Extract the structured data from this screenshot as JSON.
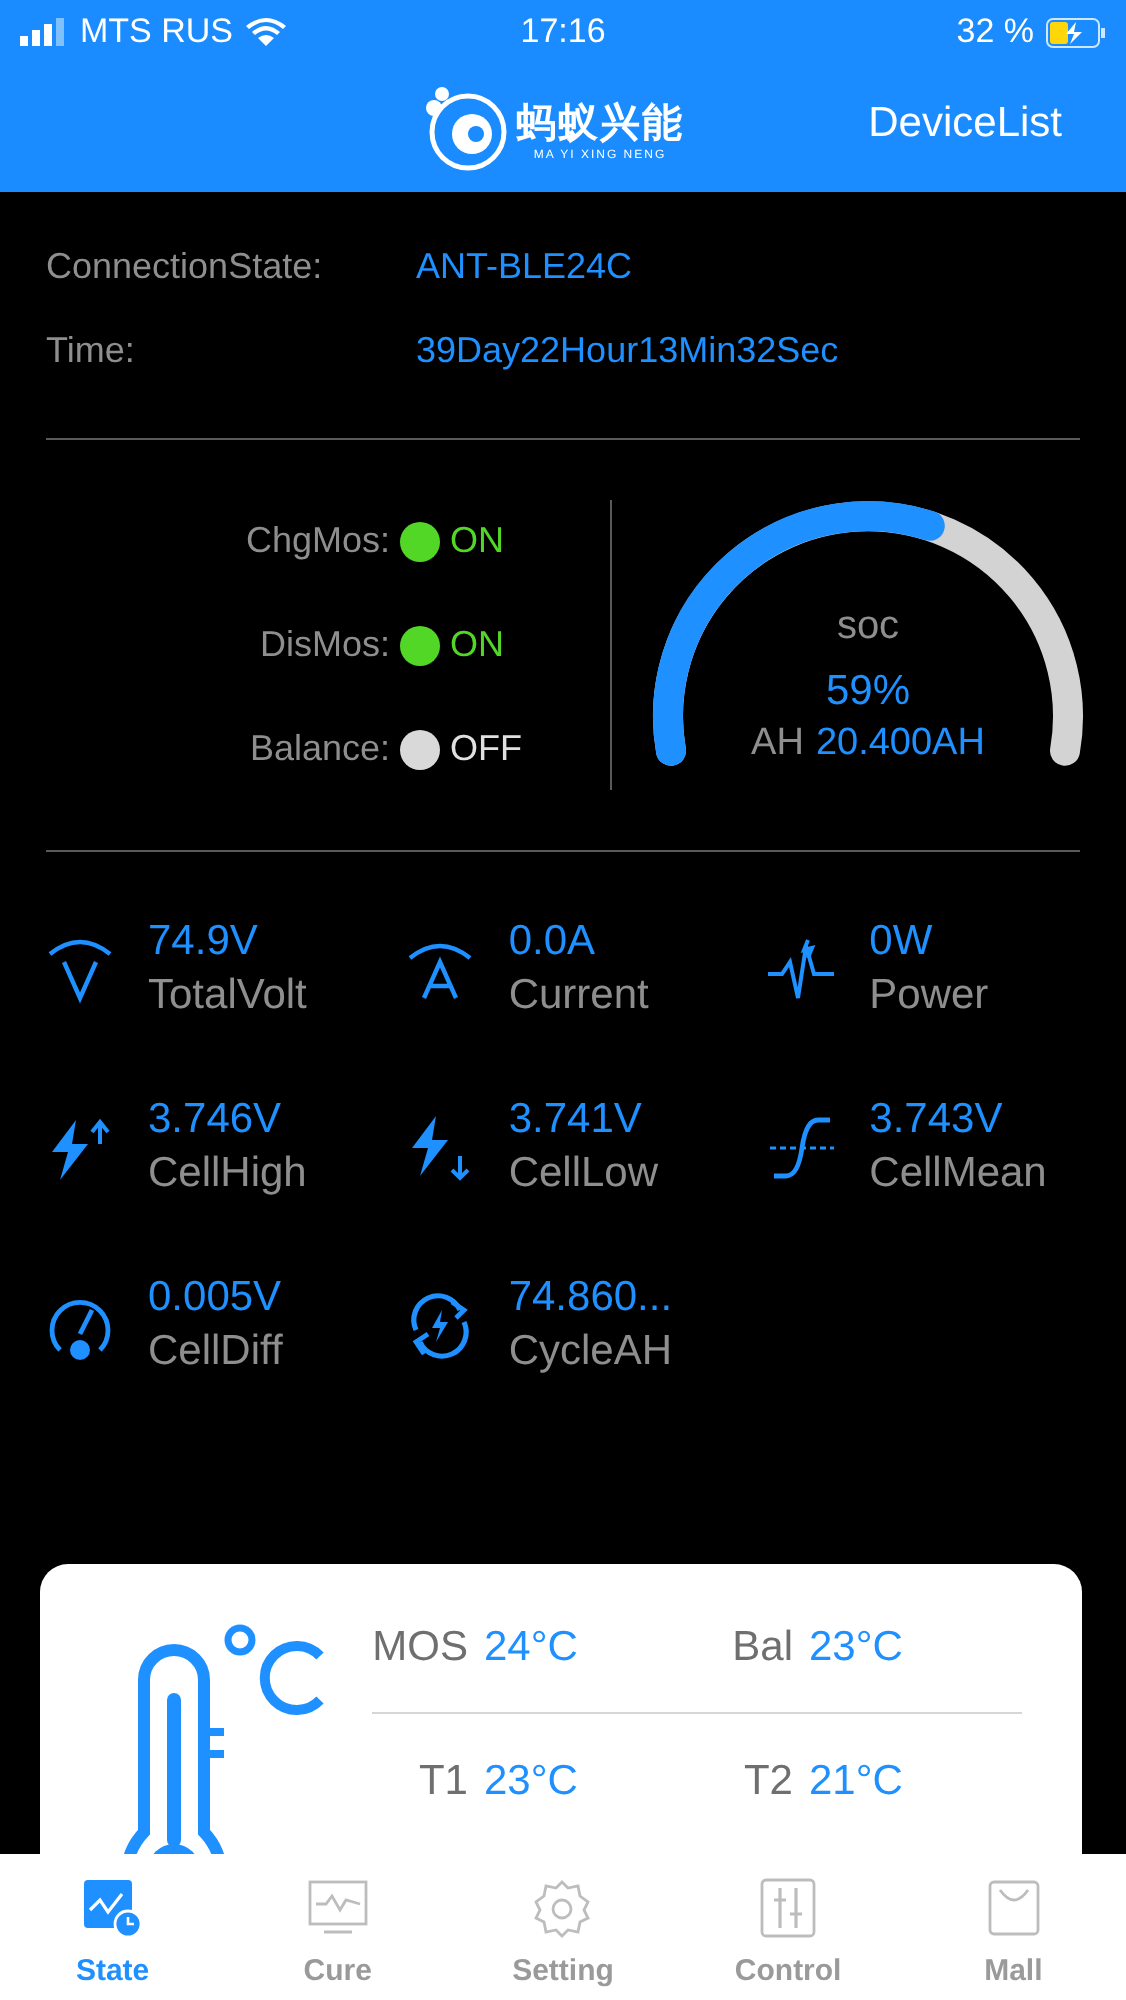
{
  "status_bar": {
    "carrier": "MTS RUS",
    "time": "17:16",
    "battery": "32 %"
  },
  "nav": {
    "logo_title": "蚂蚁兴能",
    "logo_subtitle": "MA YI XING NENG",
    "device_list": "DeviceList"
  },
  "info": [
    {
      "label": "ConnectionState:",
      "value": "ANT-BLE24C"
    },
    {
      "label": "Time:",
      "value": "39Day22Hour13Min32Sec"
    }
  ],
  "switches": [
    {
      "label": "ChgMos:",
      "on": true,
      "state": "ON"
    },
    {
      "label": "DisMos:",
      "on": true,
      "state": "ON"
    },
    {
      "label": "Balance:",
      "on": false,
      "state": "OFF"
    }
  ],
  "soc": {
    "label": "soc",
    "percent": "59%",
    "ah_label": "AH",
    "ah_value": "20.400AH"
  },
  "metrics": [
    {
      "kind": "volt",
      "value": "74.9V",
      "label": "TotalVolt"
    },
    {
      "kind": "amp",
      "value": "0.0A",
      "label": "Current"
    },
    {
      "kind": "power",
      "value": "0W",
      "label": "Power"
    },
    {
      "kind": "high",
      "value": "3.746V",
      "label": "CellHigh"
    },
    {
      "kind": "low",
      "value": "3.741V",
      "label": "CellLow"
    },
    {
      "kind": "mean",
      "value": "3.743V",
      "label": "CellMean"
    },
    {
      "kind": "diff",
      "value": "0.005V",
      "label": "CellDiff"
    },
    {
      "kind": "cycle",
      "value": "74.860...",
      "label": "CycleAH"
    }
  ],
  "temperatures": [
    [
      {
        "label": "MOS",
        "value": "24°C"
      },
      {
        "label": "Bal",
        "value": "23°C"
      }
    ],
    [
      {
        "label": "T1",
        "value": "23°C"
      },
      {
        "label": "T2",
        "value": "21°C"
      }
    ]
  ],
  "tabs": [
    {
      "label": "State",
      "selected": true
    },
    {
      "label": "Cure",
      "selected": false
    },
    {
      "label": "Setting",
      "selected": false
    },
    {
      "label": "Control",
      "selected": false
    },
    {
      "label": "Mall",
      "selected": false
    }
  ]
}
